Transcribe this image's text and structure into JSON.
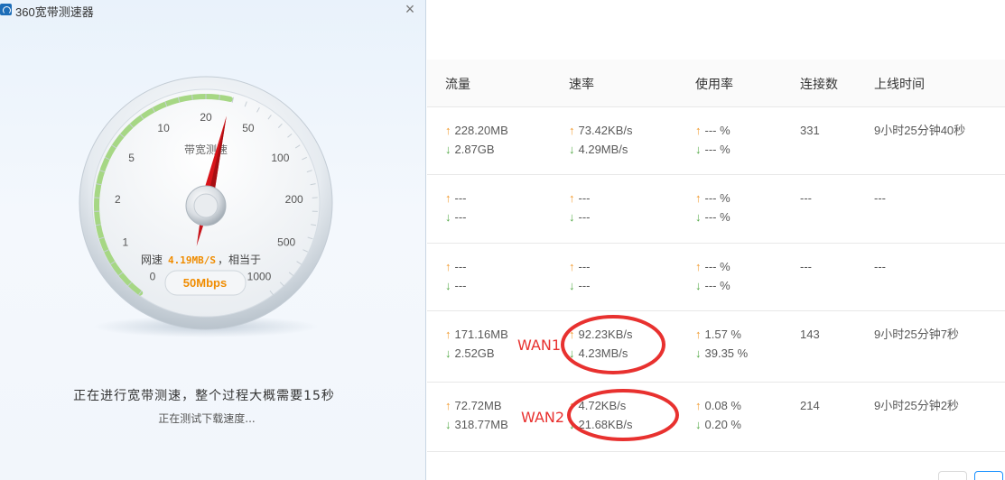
{
  "window": {
    "title": "360宽带测速器",
    "close_glyph": "×"
  },
  "gauge": {
    "label": "带宽测速",
    "ticks": [
      "0",
      "1",
      "2",
      "5",
      "10",
      "20",
      "50",
      "100",
      "200",
      "500",
      "1000"
    ],
    "speed_prefix": "网速",
    "speed_value": "4.19MB/S",
    "speed_suffix": "，相当于",
    "mbps": "50Mbps",
    "needle_value": 33.5
  },
  "status": {
    "main": "正在进行宽带测速，整个过程大概需要15秒",
    "sub": "正在测试下载速度..."
  },
  "table": {
    "headers": [
      "流量",
      "速率",
      "使用率",
      "连接数",
      "上线时间"
    ],
    "arrow_up": "↑",
    "arrow_down": "↓",
    "rows": [
      {
        "traffic_up": "228.20MB",
        "traffic_down": "2.87GB",
        "rate_up": "73.42KB/s",
        "rate_down": "4.29MB/s",
        "usage_up": "--- %",
        "usage_down": "--- %",
        "connections": "331",
        "uptime": "9小时25分钟40秒"
      },
      {
        "traffic_up": "---",
        "traffic_down": "---",
        "rate_up": "---",
        "rate_down": "---",
        "usage_up": "--- %",
        "usage_down": "--- %",
        "connections": "---",
        "uptime": "---"
      },
      {
        "traffic_up": "---",
        "traffic_down": "---",
        "rate_up": "---",
        "rate_down": "---",
        "usage_up": "--- %",
        "usage_down": "--- %",
        "connections": "---",
        "uptime": "---"
      },
      {
        "traffic_up": "171.16MB",
        "traffic_down": "2.52GB",
        "rate_up": "92.23KB/s",
        "rate_down": "4.23MB/s",
        "usage_up": "1.57 %",
        "usage_down": "39.35 %",
        "connections": "143",
        "uptime": "9小时25分钟7秒"
      },
      {
        "traffic_up": "72.72MB",
        "traffic_down": "318.77MB",
        "rate_up": "4.72KB/s",
        "rate_down": "21.68KB/s",
        "usage_up": "0.08 %",
        "usage_down": "0.20 %",
        "connections": "214",
        "uptime": "9小时25分钟2秒"
      }
    ]
  },
  "annotations": {
    "wan1": "WAN1",
    "wan2": "WAN2",
    "color": "#e8312f"
  }
}
